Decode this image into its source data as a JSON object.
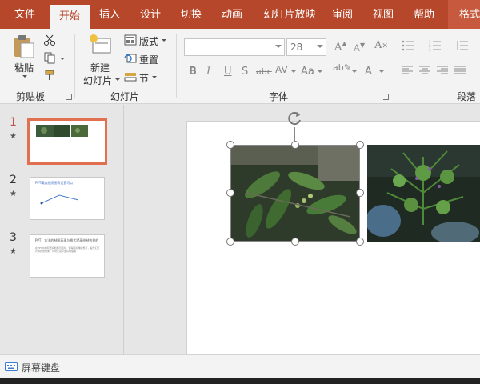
{
  "tabs": [
    "文件",
    "开始",
    "插入",
    "设计",
    "切换",
    "动画",
    "幻灯片放映",
    "审阅",
    "视图",
    "帮助",
    "格式"
  ],
  "ribbon": {
    "clipboard": {
      "paste_label": "粘贴",
      "group_label": "剪贴板"
    },
    "slides": {
      "new_slide_line1": "新建",
      "new_slide_line2": "幻灯片",
      "layout_label": "版式",
      "reset_label": "重置",
      "section_label": "节",
      "group_label": "幻灯片"
    },
    "font": {
      "font_name": "",
      "font_size": "28",
      "group_label": "字体",
      "bold": "B",
      "italic": "I",
      "underline": "U",
      "shadow": "S",
      "strike": "abc",
      "spacing": "AV",
      "case": "Aa",
      "color": "A"
    },
    "paragraph": {
      "group_label": "段落"
    }
  },
  "thumbnails": [
    {
      "number": "1",
      "star": "★",
      "active": true
    },
    {
      "number": "2",
      "star": "★",
      "title": "PPT精选拍照图表设置可以",
      "active": false
    },
    {
      "number": "3",
      "star": "★",
      "title": "PPT：方法的制图表现与格式提高绘制效果的",
      "body": "在PPT中如何更好地展示图片，使得图片排版整齐，提升幻灯片的视觉效果，同时让观众更好地理解",
      "active": false
    }
  ],
  "statusbar": {
    "keyboard_label": "屏幕键盘"
  },
  "colors": {
    "accent": "#b7472a",
    "thumb_active": "#e07050"
  }
}
